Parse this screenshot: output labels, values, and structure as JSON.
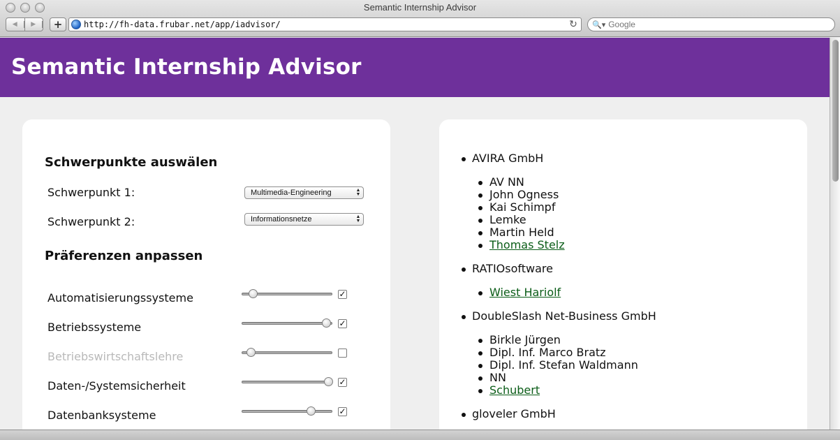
{
  "window": {
    "title": "Semantic Internship Advisor"
  },
  "toolbar": {
    "back_icon": "back-arrow-icon",
    "forward_icon": "forward-arrow-icon",
    "add_label": "+",
    "url": "http://fh-data.frubar.net/app/iadvisor/",
    "reload_icon": "reload-icon",
    "search_placeholder": "Google"
  },
  "header": {
    "title": "Semantic Internship Advisor",
    "background": "#6e309b"
  },
  "left": {
    "focus_title": "Schwerpunkte auswälen",
    "focus1_label": "Schwerpunkt 1:",
    "focus1_value": "Multimedia-Engineering",
    "focus2_label": "Schwerpunkt 2:",
    "focus2_value": "Informationsnetze",
    "prefs_title": "Präferenzen anpassen",
    "preferences": [
      {
        "label": "Automatisierungssysteme",
        "level": 0.12,
        "checked": true,
        "enabled": true
      },
      {
        "label": "Betriebssysteme",
        "level": 0.93,
        "checked": true,
        "enabled": true
      },
      {
        "label": "Betriebswirtschaftslehre",
        "level": 0.1,
        "checked": false,
        "enabled": false
      },
      {
        "label": "Daten-/Systemsicherheit",
        "level": 0.95,
        "checked": true,
        "enabled": true
      },
      {
        "label": "Datenbanksysteme",
        "level": 0.76,
        "checked": true,
        "enabled": true
      }
    ]
  },
  "right": {
    "companies": [
      {
        "name": "AVIRA GmbH",
        "contacts": [
          {
            "name": "AV NN",
            "link": false
          },
          {
            "name": "John Ogness",
            "link": false
          },
          {
            "name": "Kai Schimpf",
            "link": false
          },
          {
            "name": "Lemke",
            "link": false
          },
          {
            "name": "Martin Held",
            "link": false
          },
          {
            "name": "Thomas Stelz",
            "link": true
          }
        ]
      },
      {
        "name": "RATIOsoftware",
        "contacts": [
          {
            "name": "Wiest Hariolf",
            "link": true
          }
        ]
      },
      {
        "name": "DoubleSlash Net-Business GmbH",
        "contacts": [
          {
            "name": "Birkle Jürgen",
            "link": false
          },
          {
            "name": "Dipl. Inf. Marco Bratz",
            "link": false
          },
          {
            "name": "Dipl. Inf. Stefan Waldmann",
            "link": false
          },
          {
            "name": "NN",
            "link": false
          },
          {
            "name": "Schubert",
            "link": true
          }
        ]
      },
      {
        "name": "gloveler GmbH",
        "contacts": []
      }
    ]
  }
}
